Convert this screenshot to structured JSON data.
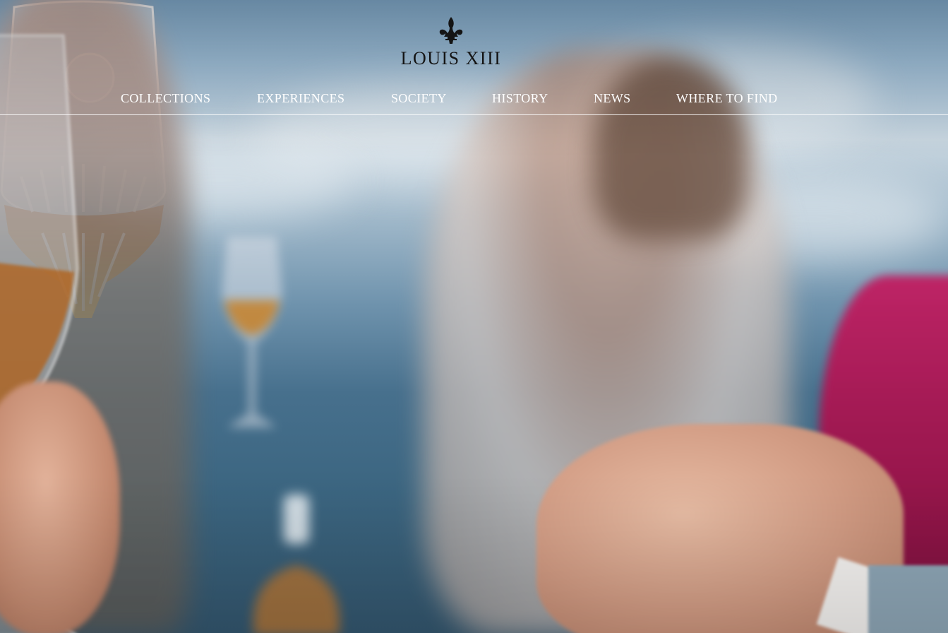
{
  "brand": {
    "name": "LOUIS XIII",
    "emblem_icon": "fleur-de-lis-icon",
    "emblem_color": "#141414"
  },
  "nav": {
    "items": [
      {
        "label": "COLLECTIONS"
      },
      {
        "label": "EXPERIENCES"
      },
      {
        "label": "SOCIETY"
      },
      {
        "label": "HISTORY"
      },
      {
        "label": "NEWS"
      },
      {
        "label": "WHERE TO FIND"
      }
    ],
    "text_color": "#ffffff",
    "divider_color": "#ffffff"
  },
  "hero": {
    "media_type": "background-video",
    "dominant_colors": [
      "#7ea6c6",
      "#3b6580",
      "#c21e62",
      "#d29c84"
    ]
  }
}
